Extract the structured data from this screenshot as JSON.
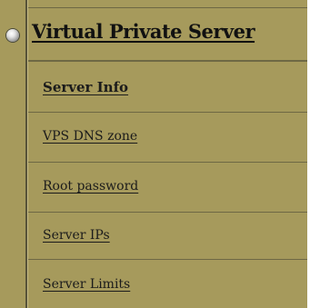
{
  "menu": {
    "header_label": "Virtual Private Server",
    "items": [
      {
        "label": "Server Info",
        "bold": true
      },
      {
        "label": "VPS DNS zone",
        "bold": false
      },
      {
        "label": "Root password",
        "bold": false
      },
      {
        "label": "Server IPs",
        "bold": false
      },
      {
        "label": "Server Limits",
        "bold": false
      }
    ]
  },
  "colors": {
    "background": "#a69a5c",
    "divider": "#575339",
    "text": "#1b1b1b"
  },
  "icons": {
    "header_bullet": "radio-bullet-icon"
  }
}
